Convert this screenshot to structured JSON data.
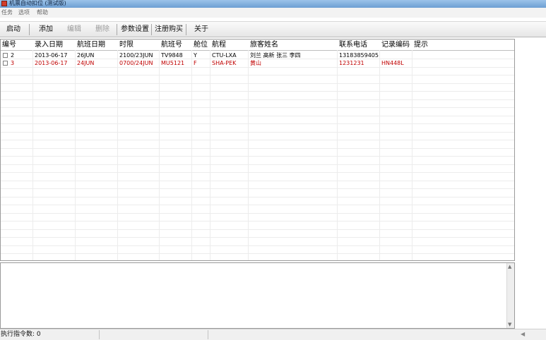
{
  "window": {
    "title": "机票自动扣位 (测试版)"
  },
  "menu": [
    {
      "label": "任务"
    },
    {
      "label": "选项"
    },
    {
      "label": "帮助"
    }
  ],
  "toolbar": [
    {
      "label": "启动",
      "enabled": true
    },
    {
      "label": "添加",
      "enabled": true
    },
    {
      "label": "编辑",
      "enabled": false
    },
    {
      "label": "删除",
      "enabled": false
    },
    {
      "label": "参数设置",
      "enabled": true
    },
    {
      "label": "注册购买",
      "enabled": true
    },
    {
      "label": "关于",
      "enabled": true
    }
  ],
  "table": {
    "columns": [
      "编号",
      "录入日期",
      "航班日期",
      "时限",
      "航班号",
      "舱位",
      "航程",
      "旅客姓名",
      "联系电话",
      "记录编码",
      "提示"
    ],
    "rows": [
      {
        "checked": false,
        "color": "#000000",
        "cells": [
          "2",
          "2013-06-17",
          "26JUN",
          "2100/23JUN",
          "TV9848",
          "Y",
          "CTU-LXA",
          "刘兰 高新 张三 李四",
          "13183859405",
          "",
          ""
        ]
      },
      {
        "checked": false,
        "color": "#c00000",
        "cells": [
          "3",
          "2013-06-17",
          "24JUN",
          "0700/24JUN",
          "MU5121",
          "F",
          "SHA-PEK",
          "黄山",
          "1231231",
          "HN448L",
          ""
        ]
      }
    ]
  },
  "status": {
    "label": "执行指令数: 0"
  }
}
